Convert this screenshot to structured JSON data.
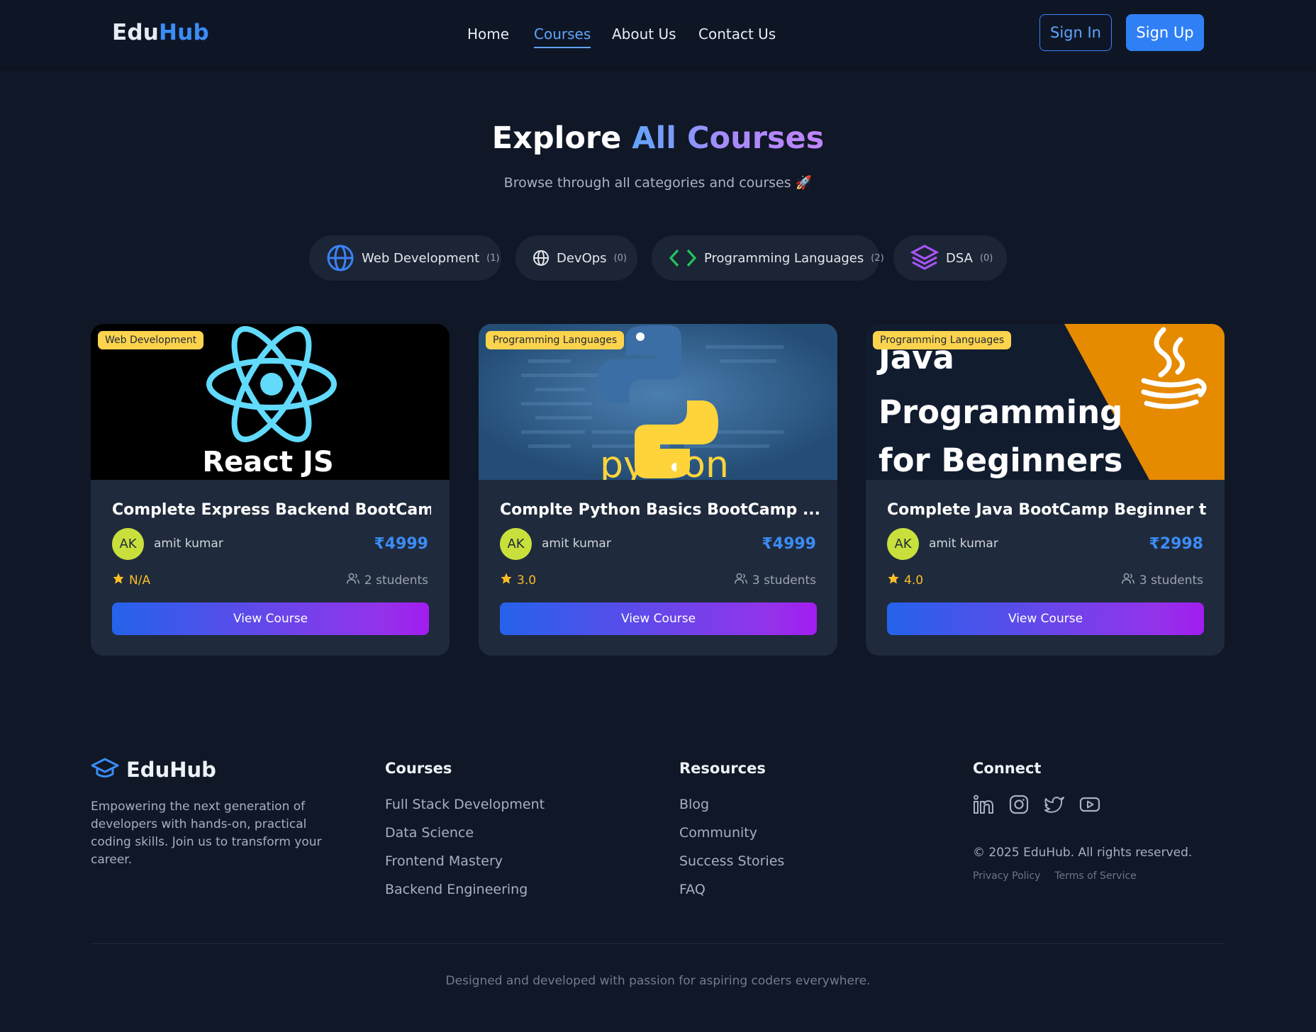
{
  "brand": {
    "part1": "Edu",
    "part2": "Hub",
    "accent": "#3b8cf5"
  },
  "nav": {
    "links": [
      "Home",
      "Courses",
      "About Us",
      "Contact Us"
    ],
    "active": "Courses",
    "sign_in": "Sign In",
    "sign_up": "Sign Up"
  },
  "hero": {
    "title_plain": "Explore ",
    "title_highlight": "All Courses",
    "subtitle": "Browse through all categories and courses 🚀"
  },
  "categories": [
    {
      "label": "Web Development",
      "count": "(1)",
      "icon": "globe-icon"
    },
    {
      "label": "DevOps",
      "count": "(0)",
      "icon": "globe-icon"
    },
    {
      "label": "Programming Languages",
      "count": "(2)",
      "icon": "code-icon"
    },
    {
      "label": "DSA",
      "count": "(0)",
      "icon": "layers-icon"
    }
  ],
  "courses": [
    {
      "badge": "Web Development",
      "thumb_text": "React JS",
      "title": "Complete Express Backend BootCamp B...",
      "avatar": "AK",
      "author": "amit kumar",
      "price": "₹4999",
      "rating": "N/A",
      "students": "2 students",
      "button": "View Course"
    },
    {
      "badge": "Programming Languages",
      "thumb_text": "python",
      "title": "Complte Python Basics BootCamp ...",
      "avatar": "AK",
      "author": "amit kumar",
      "price": "₹4999",
      "rating": "3.0",
      "students": "3 students",
      "button": "View Course"
    },
    {
      "badge": "Programming Languages",
      "thumb_lines": [
        "Java",
        "Programming",
        "for Beginners"
      ],
      "title": "Complete Java BootCamp Beginner to ...",
      "avatar": "AK",
      "author": "amit kumar",
      "price": "₹2998",
      "rating": "4.0",
      "students": "3 students",
      "button": "View Course"
    }
  ],
  "footer": {
    "brand": "EduHub",
    "description": "Empowering the next generation of developers with hands-on, practical coding skills. Join us to transform your career.",
    "courses": {
      "heading": "Courses",
      "items": [
        "Full Stack Development",
        "Data Science",
        "Frontend Mastery",
        "Backend Engineering"
      ]
    },
    "resources": {
      "heading": "Resources",
      "items": [
        "Blog",
        "Community",
        "Success Stories",
        "FAQ"
      ]
    },
    "connect": {
      "heading": "Connect",
      "socials": [
        "linkedin-icon",
        "instagram-icon",
        "twitter-icon",
        "youtube-icon"
      ]
    },
    "copyright": "© 2025 EduHub. All rights reserved.",
    "legal": [
      "Privacy Policy",
      "Terms of Service"
    ],
    "bottom": "Designed and developed with passion for aspiring coders everywhere."
  }
}
